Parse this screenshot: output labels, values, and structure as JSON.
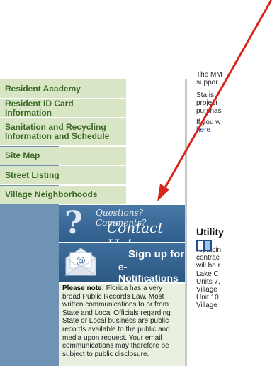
{
  "sidebar": {
    "items": [
      {
        "label": "Resident Academy"
      },
      {
        "label": "Resident ID Card Information"
      },
      {
        "label": "Sanitation and Recycling Information and Schedule"
      },
      {
        "label": "Site Map"
      },
      {
        "label": "Street Listing"
      },
      {
        "label": "Village Neighborhoods"
      }
    ],
    "contact_banner": {
      "line1": "Questions? Comments?",
      "line2": "Contact Us!"
    },
    "enotify_banner": {
      "line1": "Sign up for",
      "line2": "e-Notifications"
    },
    "notice": {
      "bold": "Please note:",
      "text": "Florida has a very broad Public Records Law. Most written communications to or from State and Local Officials regarding State or Local business are public records available to the public and media upon request. Your email communications may therefore be subject to public disclosure."
    }
  },
  "main": {
    "p1": "The MM\nsuppor",
    "p2": "Sta is\nproject\npurchas",
    "p3_prefix": "If you w",
    "p3_link": "here",
    "heading": "Utility",
    "p4": "replacin\ncontrac\nwill be r",
    "p5": "Lake C\nUnits 7,\nVillage\nUnit 10\nVillage"
  },
  "colors": {
    "annotation_arrow": "#d9261c",
    "sidebar_band": "#6f93b5",
    "nav_item_bg": "#d9e6c6",
    "nav_text": "#3b6a26"
  }
}
